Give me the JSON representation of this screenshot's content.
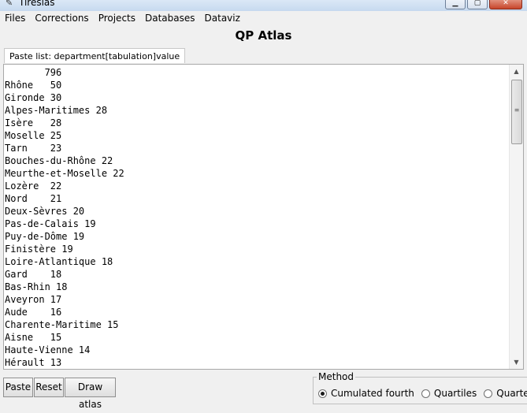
{
  "window": {
    "title": "Tiresias",
    "app_icon": "quill-icon",
    "controls": [
      "minimize",
      "maximize",
      "close"
    ]
  },
  "menu": [
    "Files",
    "Corrections",
    "Projects",
    "Databases",
    "Dataviz"
  ],
  "app_title": "QP Atlas",
  "tab_label": "Paste list: department[tabulation]value",
  "text_lines": [
    "       796",
    "Rhône   50",
    "Gironde 30",
    "Alpes-Maritimes 28",
    "Isère   28",
    "Moselle 25",
    "Tarn    23",
    "Bouches-du-Rhône 22",
    "Meurthe-et-Moselle 22",
    "Lozère  22",
    "Nord    21",
    "Deux-Sèvres 20",
    "Pas-de-Calais 19",
    "Puy-de-Dôme 19",
    "Finistère 19",
    "Loire-Atlantique 18",
    "Gard    18",
    "Bas-Rhin 18",
    "Aveyron 17",
    "Aude    16",
    "Charente-Maritime 15",
    "Aisne   15",
    "Haute-Vienne 14",
    "Hérault 13"
  ],
  "buttons": {
    "paste": "Paste",
    "reset": "Reset",
    "draw": "Draw atlas"
  },
  "method": {
    "legend": "Method",
    "options": [
      "Cumulated fourth",
      "Quartiles",
      "Quarter"
    ],
    "selected": "Cumulated fourth"
  }
}
